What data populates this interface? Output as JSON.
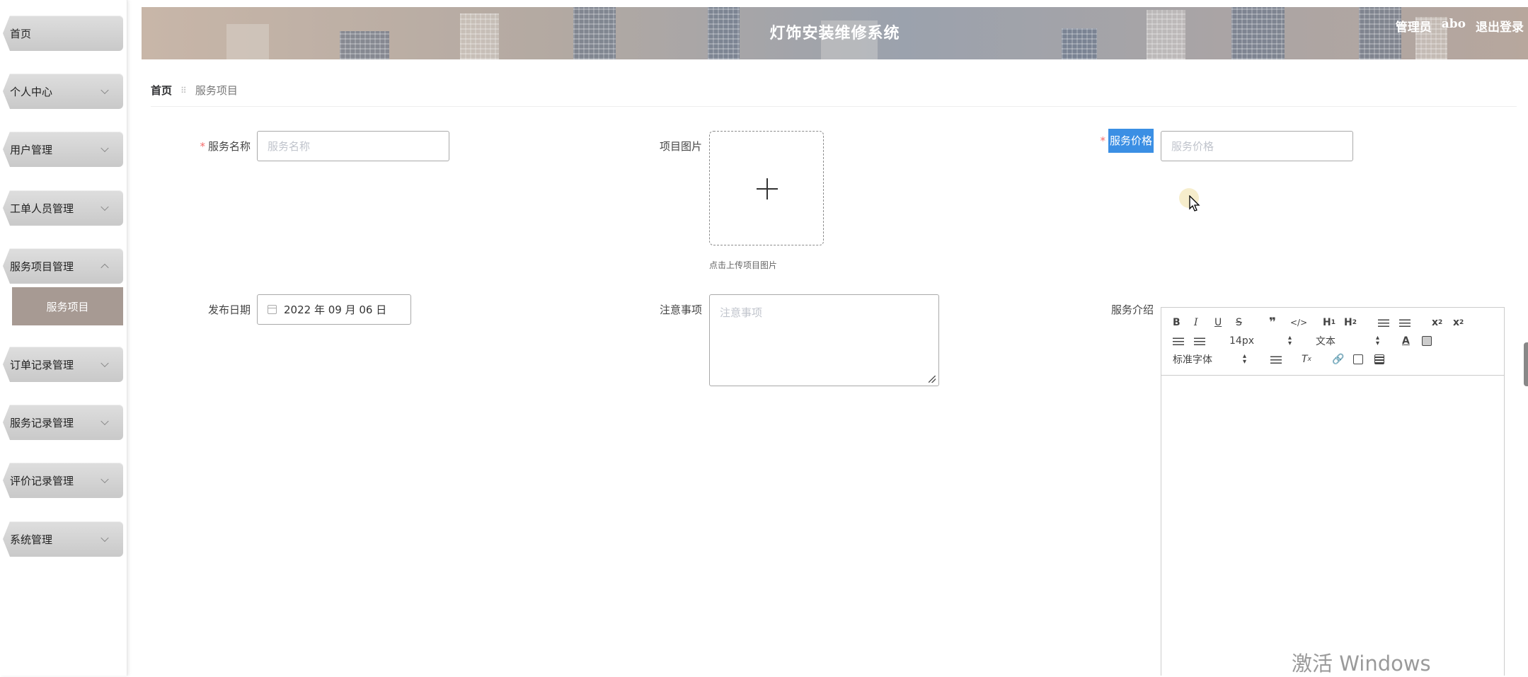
{
  "sidebar": {
    "items": [
      {
        "label": "首页"
      },
      {
        "label": "个人中心"
      },
      {
        "label": "用户管理"
      },
      {
        "label": "工单人员管理"
      },
      {
        "label": "服务项目管理"
      },
      {
        "label": "订单记录管理"
      },
      {
        "label": "服务记录管理"
      },
      {
        "label": "评价记录管理"
      },
      {
        "label": "系统管理"
      }
    ],
    "active_sub": "服务项目"
  },
  "header": {
    "title": "灯饰安装维修系统",
    "role": "管理员",
    "username": "abo",
    "logout": "退出登录"
  },
  "breadcrumb": {
    "home": "首页",
    "current": "服务项目"
  },
  "form": {
    "service_name": {
      "label": "服务名称",
      "placeholder": "服务名称",
      "required": true
    },
    "project_image": {
      "label": "项目图片",
      "tip": "点击上传项目图片"
    },
    "service_price": {
      "label": "服务价格",
      "placeholder": "服务价格",
      "required": true
    },
    "publish_date": {
      "label": "发布日期",
      "value": "2022 年 09 月 06 日"
    },
    "notes": {
      "label": "注意事项",
      "placeholder": "注意事项"
    },
    "service_intro": {
      "label": "服务介绍"
    }
  },
  "editor": {
    "font_size": "14px",
    "block_format": "文本",
    "font_family": "标准字体"
  },
  "watermark": "激活 Windows"
}
